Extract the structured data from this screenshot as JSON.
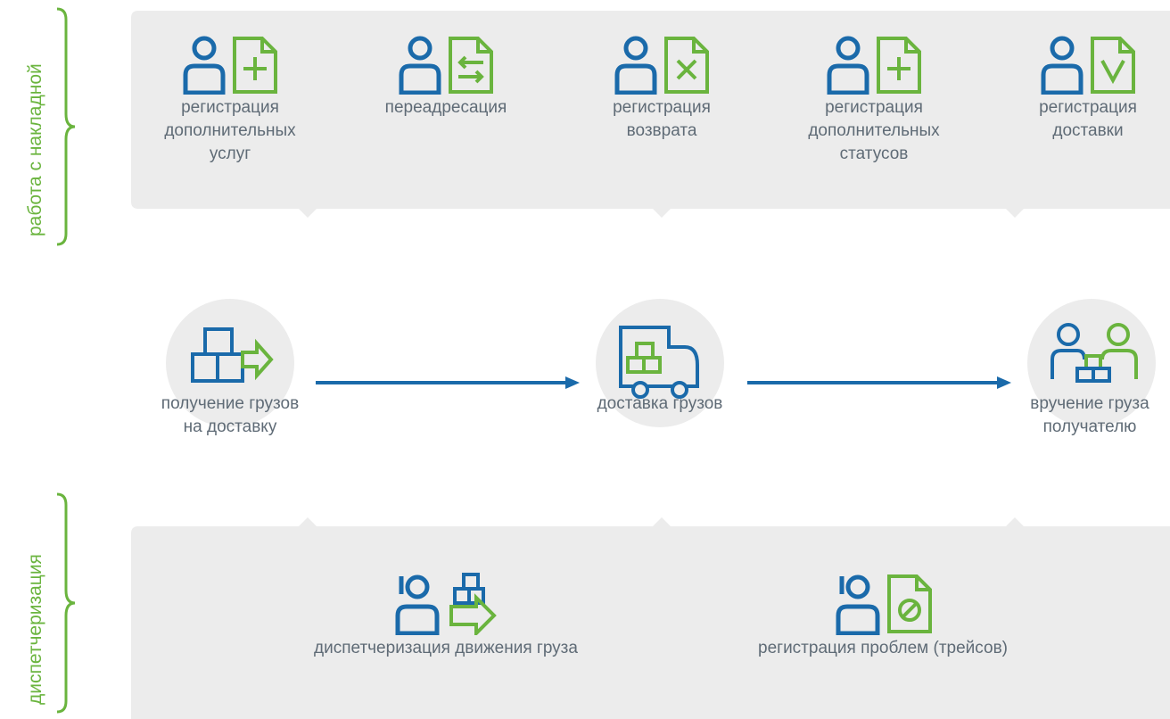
{
  "colors": {
    "blue": "#1a6aaa",
    "green": "#6ab43e",
    "text": "#5f6b76",
    "panel": "#ececec"
  },
  "side_labels": {
    "top": "работа с накладной",
    "bottom": "диспетчеризация"
  },
  "top_items": [
    {
      "label": "регистрация\nдополнительных\nуслуг",
      "icons": [
        "user-icon",
        "doc-plus-icon"
      ]
    },
    {
      "label": "переадресация",
      "icons": [
        "user-icon",
        "doc-swap-icon"
      ]
    },
    {
      "label": "регистрация\nвозврата",
      "icons": [
        "user-icon",
        "doc-cross-icon"
      ]
    },
    {
      "label": "регистрация\nдополнительных\nстатусов",
      "icons": [
        "user-icon",
        "doc-plus-icon"
      ]
    },
    {
      "label": "регистрация\nдоставки",
      "icons": [
        "user-icon",
        "doc-check-icon"
      ]
    }
  ],
  "flow": [
    {
      "label": "получение грузов\nна доставку",
      "icon": "boxes-arrow-icon"
    },
    {
      "label": "доставка грузов",
      "icon": "truck-icon"
    },
    {
      "label": "вручение груза\nполучателю",
      "icon": "handover-icon"
    }
  ],
  "bottom_items": [
    {
      "label": "диспетчеризация движения груза",
      "icons": [
        "operator-icon",
        "boxes-arrow-icon"
      ]
    },
    {
      "label": "регистрация проблем (трейсов)",
      "icons": [
        "operator-icon",
        "doc-forbidden-icon"
      ]
    }
  ]
}
